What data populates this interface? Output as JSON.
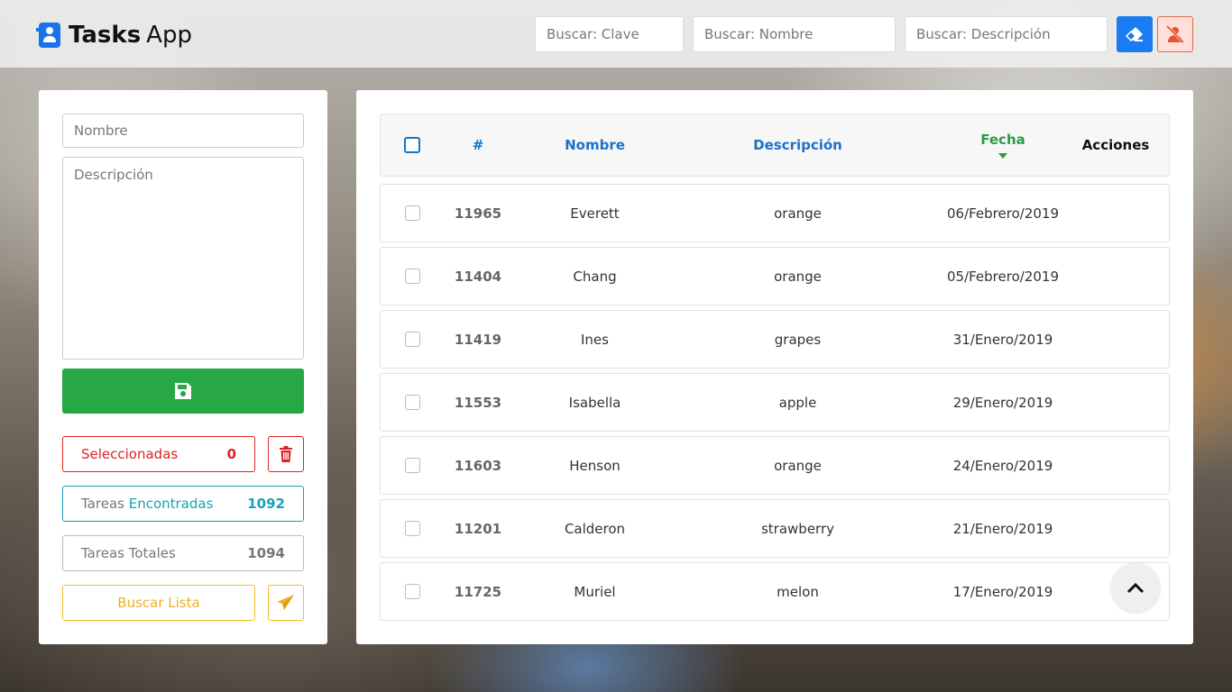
{
  "app": {
    "brand_bold": "Tasks",
    "brand_rest": "App"
  },
  "search": {
    "clave_placeholder": "Buscar: Clave",
    "nombre_placeholder": "Buscar: Nombre",
    "descripcion_placeholder": "Buscar: Descripción"
  },
  "form": {
    "nombre_placeholder": "Nombre",
    "descripcion_placeholder": "Descripción"
  },
  "stats": {
    "seleccionadas_label": "Seleccionadas",
    "seleccionadas_value": "0",
    "encontradas_label_prefix": "Tareas",
    "encontradas_label_accent": "Encontradas",
    "encontradas_value": "1092",
    "totales_label": "Tareas Totales",
    "totales_value": "1094"
  },
  "buscar_lista_label": "Buscar Lista",
  "table": {
    "headers": {
      "num": "#",
      "nombre": "Nombre",
      "descripcion": "Descripción",
      "fecha": "Fecha",
      "acciones": "Acciones"
    },
    "rows": [
      {
        "num": "11965",
        "nombre": "Everett",
        "descripcion": "orange",
        "fecha": "06/Febrero/2019"
      },
      {
        "num": "11404",
        "nombre": "Chang",
        "descripcion": "orange",
        "fecha": "05/Febrero/2019"
      },
      {
        "num": "11419",
        "nombre": "Ines",
        "descripcion": "grapes",
        "fecha": "31/Enero/2019"
      },
      {
        "num": "11553",
        "nombre": "Isabella",
        "descripcion": "apple",
        "fecha": "29/Enero/2019"
      },
      {
        "num": "11603",
        "nombre": "Henson",
        "descripcion": "orange",
        "fecha": "24/Enero/2019"
      },
      {
        "num": "11201",
        "nombre": "Calderon",
        "descripcion": "strawberry",
        "fecha": "21/Enero/2019"
      },
      {
        "num": "11725",
        "nombre": "Muriel",
        "descripcion": "melon",
        "fecha": "17/Enero/2019"
      }
    ]
  },
  "colors": {
    "primary": "#1a7cf0",
    "success": "#28a745",
    "danger": "#dd2222",
    "info": "#17a2b8",
    "warning": "#f0c020"
  },
  "icons": {
    "brand": "address-book-icon",
    "eraser": "eraser-icon",
    "unassign": "user-slash-icon",
    "save": "floppy-disk-icon",
    "trash": "trash-icon",
    "send": "paper-plane-icon",
    "scroll_top": "chevron-up-icon"
  }
}
